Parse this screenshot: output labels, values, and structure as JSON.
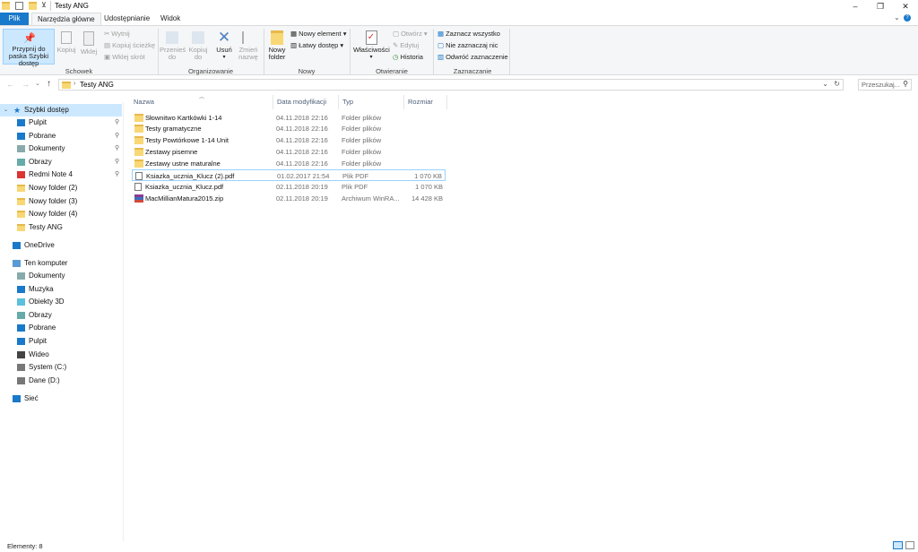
{
  "window": {
    "title": "Testy ANG",
    "controls": {
      "minimize": "–",
      "maximize": "❐",
      "close": "✕"
    }
  },
  "ribbon_tabs": [
    "Plik",
    "Narzędzia główne",
    "Udostępnianie",
    "Widok"
  ],
  "ribbon": {
    "schowek": {
      "label": "Schowek",
      "pin_label": "Przypnij do paska Szybki dostęp",
      "kopiuj": "Kopiuj",
      "wklej": "Wklej",
      "wytnij": "Wytnij",
      "kopiuj_sciezke": "Kopiuj ścieżkę",
      "wklej_skrot": "Wklej skrót"
    },
    "organizowanie": {
      "label": "Organizowanie",
      "przenies": "Przenieś do",
      "kopiuj_do": "Kopiuj do",
      "usun": "Usuń",
      "zmien_nazwe": "Zmień nazwę"
    },
    "nowy": {
      "label": "Nowy",
      "nowy_folder": "Nowy folder",
      "nowy_element": "Nowy element ▾",
      "latwy_dostep": "Łatwy dostęp ▾"
    },
    "otwieranie": {
      "label": "Otwieranie",
      "wlasciwosci": "Właściwości",
      "otworz": "Otwórz ▾",
      "edytuj": "Edytuj",
      "historia": "Historia"
    },
    "zaznaczanie": {
      "label": "Zaznaczanie",
      "zaznacz_wszystko": "Zaznacz wszystko",
      "nie_zaznaczaj": "Nie zaznaczaj nic",
      "odwroc": "Odwróć zaznaczenie"
    }
  },
  "address": {
    "path": "Testy ANG",
    "search_placeholder": "Przeszukaj..."
  },
  "nav": {
    "quick_access": "Szybki dostęp",
    "quick_items": [
      {
        "label": "Pulpit",
        "icon": "desktop-icon",
        "pinned": true
      },
      {
        "label": "Pobrane",
        "icon": "download-icon",
        "pinned": true
      },
      {
        "label": "Dokumenty",
        "icon": "documents-icon",
        "pinned": true
      },
      {
        "label": "Obrazy",
        "icon": "pictures-icon",
        "pinned": true
      },
      {
        "label": "Redmi Note 4",
        "icon": "phone-icon",
        "pinned": true
      },
      {
        "label": "Nowy folder (2)",
        "icon": "folder-icon",
        "pinned": false
      },
      {
        "label": "Nowy folder (3)",
        "icon": "folder-icon",
        "pinned": false
      },
      {
        "label": "Nowy folder (4)",
        "icon": "folder-icon",
        "pinned": false
      },
      {
        "label": "Testy ANG",
        "icon": "folder-icon",
        "pinned": false
      }
    ],
    "onedrive": "OneDrive",
    "this_pc": "Ten komputer",
    "pc_items": [
      {
        "label": "Dokumenty",
        "icon": "documents-icon"
      },
      {
        "label": "Muzyka",
        "icon": "music-icon"
      },
      {
        "label": "Obiekty 3D",
        "icon": "3d-objects-icon"
      },
      {
        "label": "Obrazy",
        "icon": "pictures-icon"
      },
      {
        "label": "Pobrane",
        "icon": "download-icon"
      },
      {
        "label": "Pulpit",
        "icon": "desktop-icon"
      },
      {
        "label": "Wideo",
        "icon": "video-icon"
      },
      {
        "label": "System (C:)",
        "icon": "drive-icon"
      },
      {
        "label": "Dane (D:)",
        "icon": "drive-icon"
      }
    ],
    "network": "Sieć"
  },
  "columns": {
    "name": "Nazwa",
    "date": "Data modyfikacji",
    "type": "Typ",
    "size": "Rozmiar"
  },
  "files": [
    {
      "name": "Słownitwo Kartkówki 1-14",
      "date": "04.11.2018 22:16",
      "type": "Folder plików",
      "size": "",
      "kind": "folder"
    },
    {
      "name": "Testy gramatyczne",
      "date": "04.11.2018 22:16",
      "type": "Folder plików",
      "size": "",
      "kind": "folder"
    },
    {
      "name": "Testy Powtórkowe 1-14 Unit",
      "date": "04.11.2018 22:16",
      "type": "Folder plików",
      "size": "",
      "kind": "folder"
    },
    {
      "name": "Zestawy pisemne",
      "date": "04.11.2018 22:16",
      "type": "Folder plików",
      "size": "",
      "kind": "folder"
    },
    {
      "name": "Zestawy ustne maturalne",
      "date": "04.11.2018 22:16",
      "type": "Folder plików",
      "size": "",
      "kind": "folder"
    },
    {
      "name": "Ksiazka_ucznia_Klucz (2).pdf",
      "date": "01.02.2017 21:54",
      "type": "Plik PDF",
      "size": "1 070 KB",
      "kind": "pdf"
    },
    {
      "name": "Ksiazka_ucznia_Klucz.pdf",
      "date": "02.11.2018 20:19",
      "type": "Plik PDF",
      "size": "1 070 KB",
      "kind": "pdf"
    },
    {
      "name": "MacMillianMatura2015.zip",
      "date": "02.11.2018 20:19",
      "type": "Archiwum WinRA...",
      "size": "14 428 KB",
      "kind": "zip"
    }
  ],
  "status": {
    "text": "Elementy: 8"
  },
  "colors": {
    "accent": "#1979ca",
    "selection": "#cce8ff",
    "ribbon_bg": "#f5f6f7"
  }
}
